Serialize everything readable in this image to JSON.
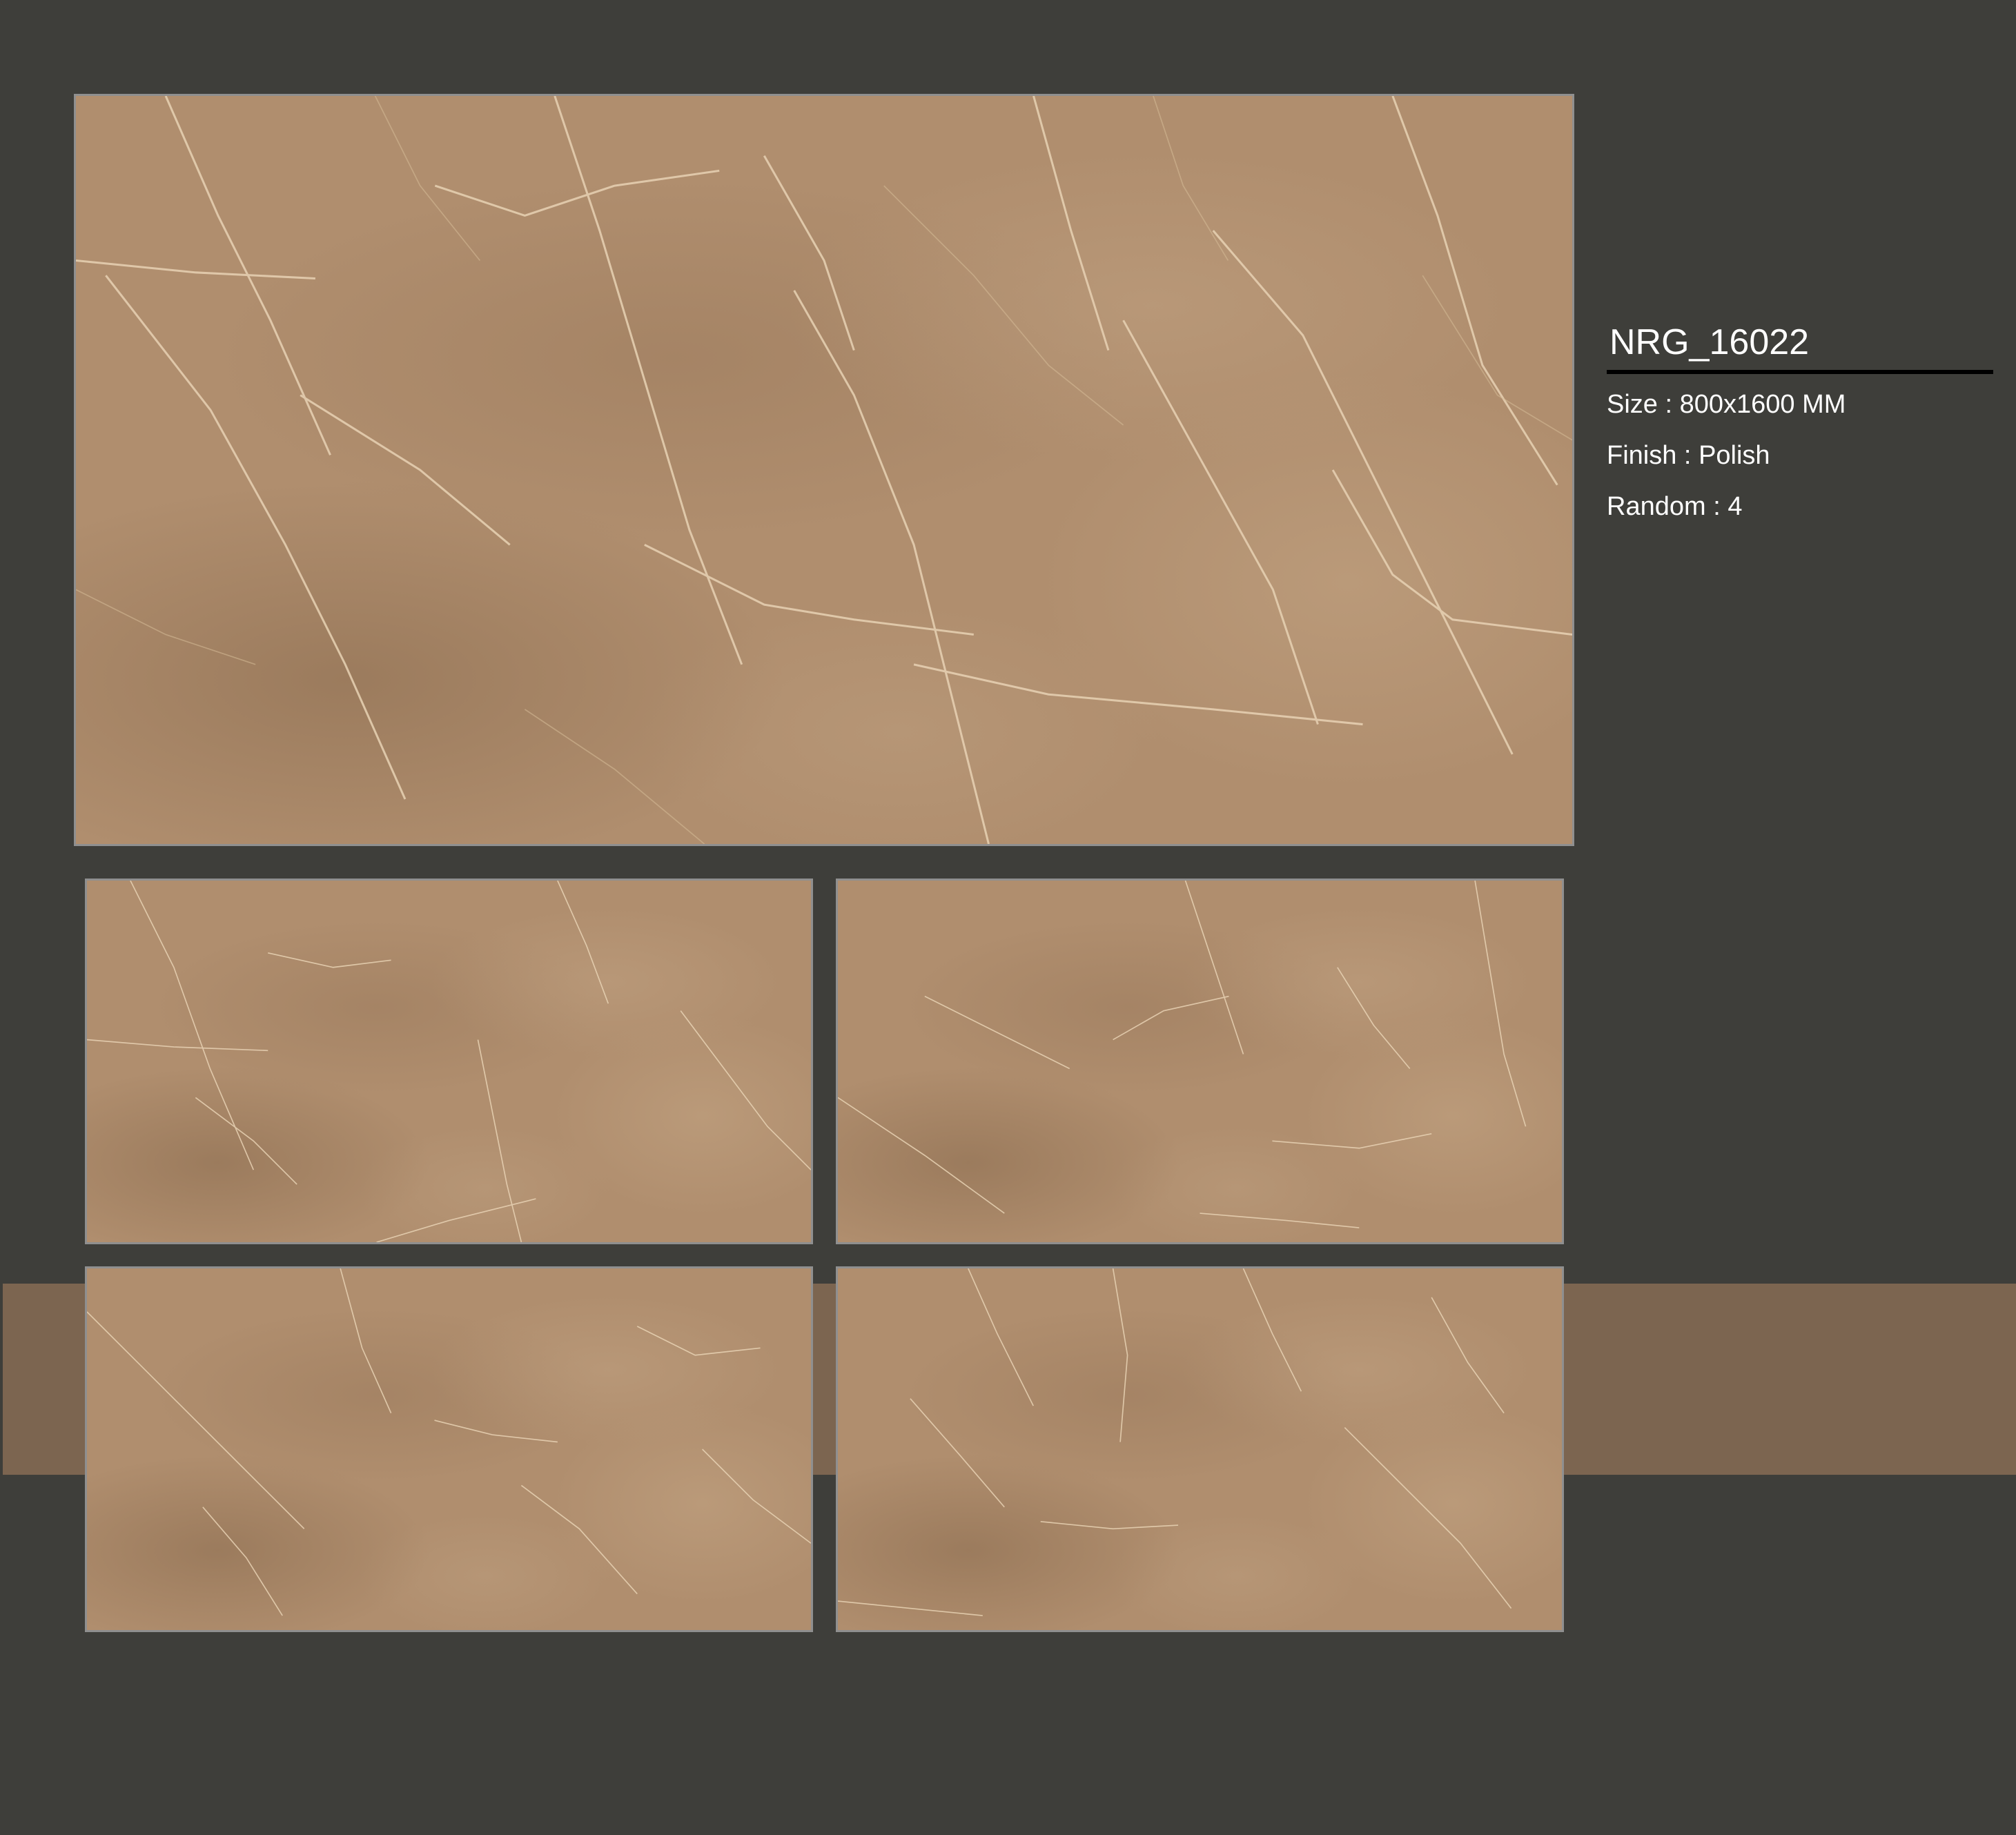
{
  "colors": {
    "background": "#3e3e3a",
    "accent_band": "#7c6550",
    "tile_base": "#b08e6e",
    "title_rule": "#000000",
    "text": "#ffffff"
  },
  "product": {
    "code": "NRG_16022",
    "specs": [
      {
        "label": "Size",
        "value": "800x1600 MM"
      },
      {
        "label": "Finish",
        "value": "Polish"
      },
      {
        "label": "Random",
        "value": "4"
      }
    ]
  },
  "tiles": {
    "main": {
      "name": "main-tile"
    },
    "variations": [
      "variation-1",
      "variation-2",
      "variation-3",
      "variation-4"
    ]
  }
}
